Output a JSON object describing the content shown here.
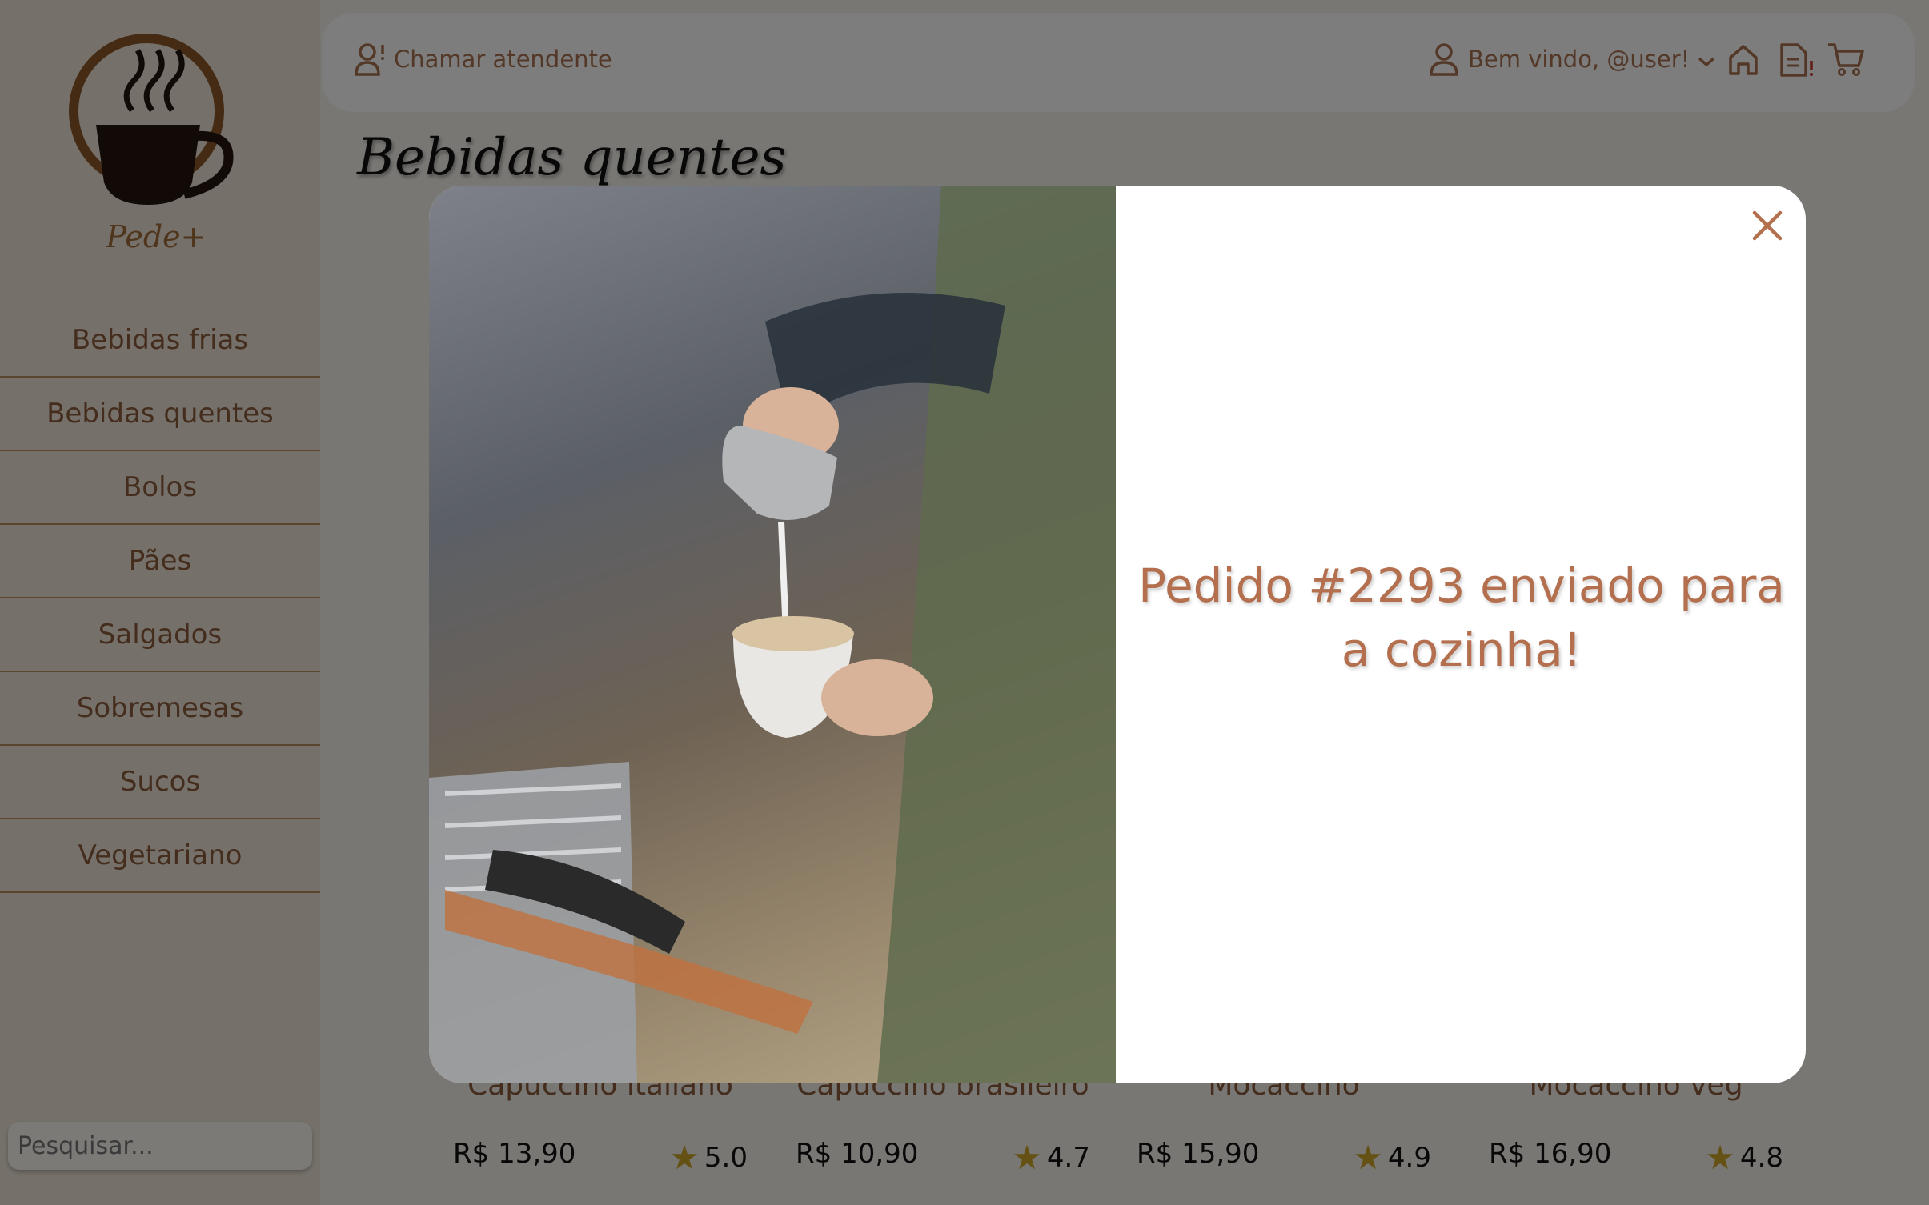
{
  "app": {
    "logo_text": "Pede+"
  },
  "sidebar": {
    "items": [
      {
        "label": "Bebidas frias"
      },
      {
        "label": "Bebidas quentes"
      },
      {
        "label": "Bolos"
      },
      {
        "label": "Pães"
      },
      {
        "label": "Salgados"
      },
      {
        "label": "Sobremesas"
      },
      {
        "label": "Sucos"
      },
      {
        "label": "Vegetariano"
      }
    ],
    "search_placeholder": "Pesquisar..."
  },
  "topbar": {
    "call_label": "Chamar atendente",
    "welcome_label": "Bem vindo, @user!",
    "icons": [
      "user-call-icon",
      "user-icon",
      "chevron-down-icon",
      "home-icon",
      "orders-icon",
      "cart-icon"
    ]
  },
  "main": {
    "title": "Bebidas quentes",
    "products": [
      {
        "name": "Capuccino italiano",
        "price": "R$ 13,90",
        "rating": "5.0"
      },
      {
        "name": "Capuccino brasileiro",
        "price": "R$ 10,90",
        "rating": "4.7"
      },
      {
        "name": "Mocaccino",
        "price": "R$ 15,90",
        "rating": "4.9"
      },
      {
        "name": "Mocaccino veg",
        "price": "R$ 16,90",
        "rating": "4.8"
      }
    ]
  },
  "modal": {
    "message": "Pedido #2293 enviado para a cozinha!"
  },
  "colors": {
    "accent": "#a9704f",
    "brand_brown": "#8a5627",
    "star": "#c9a227",
    "sidebar_bg": "#ebe3d5"
  }
}
